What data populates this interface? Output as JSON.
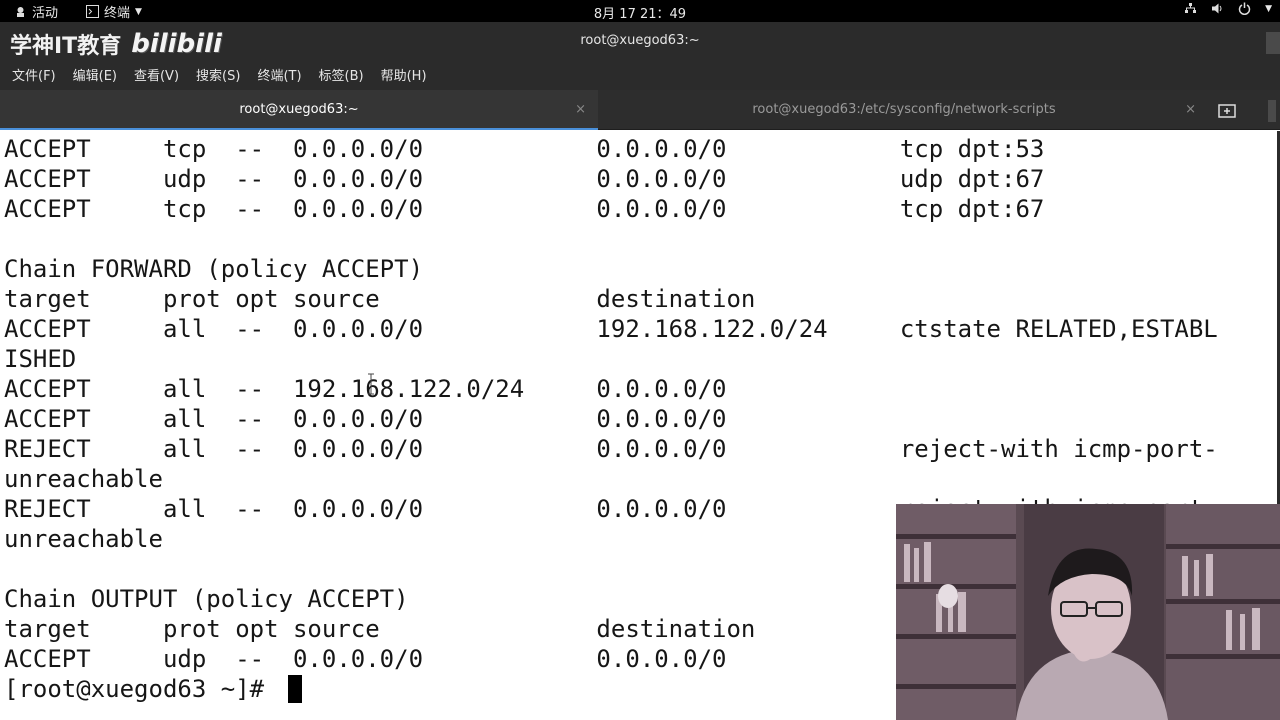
{
  "topbar": {
    "activities": "活动",
    "app_menu": "终端",
    "clock": "8月 17 21：49"
  },
  "window": {
    "title": "root@xuegod63:~",
    "watermark": "学神IT教育",
    "bilibili": "bilibili"
  },
  "menu": [
    "文件(F)",
    "编辑(E)",
    "查看(V)",
    "搜索(S)",
    "终端(T)",
    "标签(B)",
    "帮助(H)"
  ],
  "tabs": [
    {
      "label": "root@xuegod63:~"
    },
    {
      "label": "root@xuegod63:/etc/sysconfig/network-scripts"
    }
  ],
  "terminal": {
    "lines": [
      "ACCEPT     tcp  --  0.0.0.0/0            0.0.0.0/0            tcp dpt:53",
      "ACCEPT     udp  --  0.0.0.0/0            0.0.0.0/0            udp dpt:67",
      "ACCEPT     tcp  --  0.0.0.0/0            0.0.0.0/0            tcp dpt:67",
      "",
      "Chain FORWARD (policy ACCEPT)",
      "target     prot opt source               destination",
      "ACCEPT     all  --  0.0.0.0/0            192.168.122.0/24     ctstate RELATED,ESTABL",
      "ISHED",
      "ACCEPT     all  --  192.168.122.0/24     0.0.0.0/0",
      "ACCEPT     all  --  0.0.0.0/0            0.0.0.0/0",
      "REJECT     all  --  0.0.0.0/0            0.0.0.0/0            reject-with icmp-port-",
      "unreachable",
      "REJECT     all  --  0.0.0.0/0            0.0.0.0/0            reject-with icmp-port-",
      "unreachable",
      "",
      "Chain OUTPUT (policy ACCEPT)",
      "target     prot opt source               destination",
      "ACCEPT     udp  --  0.0.0.0/0            0.0.0.0/0",
      "[root@xuegod63 ~]# "
    ]
  },
  "icons": {
    "activities": "activities-icon",
    "terminal": "terminal-icon",
    "network": "network-icon",
    "volume": "volume-icon",
    "power": "power-icon",
    "new_tab": "new-tab-icon"
  }
}
